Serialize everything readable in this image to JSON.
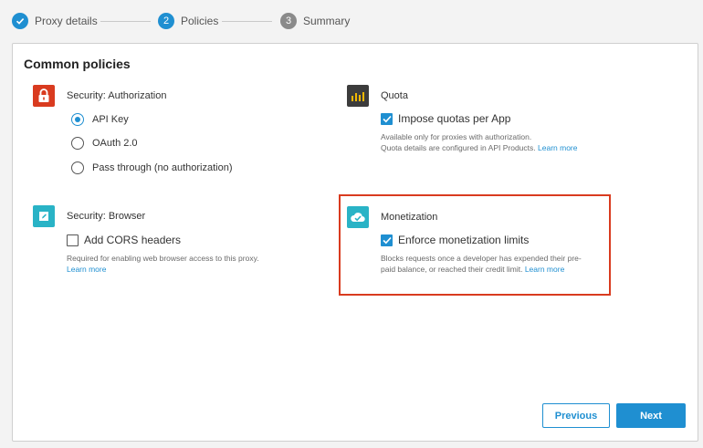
{
  "stepper": {
    "steps": [
      {
        "number": "",
        "label": "Proxy details",
        "state": "done"
      },
      {
        "number": "2",
        "label": "Policies",
        "state": "active"
      },
      {
        "number": "3",
        "label": "Summary",
        "state": "todo"
      }
    ]
  },
  "card": {
    "title": "Common policies",
    "authorization": {
      "name": "Security: Authorization",
      "icon": "lock-icon",
      "options": [
        {
          "label": "API Key",
          "checked": true
        },
        {
          "label": "OAuth 2.0",
          "checked": false
        },
        {
          "label": "Pass through (no authorization)",
          "checked": false
        }
      ]
    },
    "quota": {
      "name": "Quota",
      "icon": "bar-chart-icon",
      "checkbox_label": "Impose quotas per App",
      "checked": true,
      "help_line1": "Available only for proxies with authorization.",
      "help_line2": "Quota details are configured in API Products.",
      "link": "Learn more"
    },
    "browser": {
      "name": "Security: Browser",
      "icon": "pencil-icon",
      "checkbox_label": "Add CORS headers",
      "checked": false,
      "help_line1": "Required for enabling web browser access to this proxy.",
      "link": "Learn more"
    },
    "monetization": {
      "name": "Monetization",
      "icon": "cloud-check-icon",
      "checkbox_label": "Enforce monetization limits",
      "checked": true,
      "help_line1": "Blocks requests once a developer has expended their pre-",
      "help_line2": "paid balance, or reached their credit limit.",
      "link": "Learn more"
    }
  },
  "footer": {
    "previous_label": "Previous",
    "next_label": "Next"
  },
  "colors": {
    "accent": "#1f8fd1",
    "highlight": "#d93b1f"
  }
}
